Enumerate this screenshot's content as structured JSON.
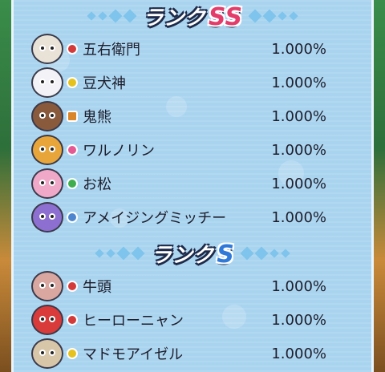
{
  "sections": [
    {
      "title_word": "ランク",
      "title_letter": "SS",
      "rows": [
        {
          "name": "五右衛門",
          "rate": "1.000%",
          "avatar_color": "#e9e2d6",
          "tribe_color": "#d43a3a",
          "tribe_icon": "brave-tribe-icon"
        },
        {
          "name": "豆犬神",
          "rate": "1.000%",
          "avatar_color": "#f2f2f7",
          "tribe_color": "#e6c21f",
          "tribe_icon": "mysterious-tribe-icon"
        },
        {
          "name": "鬼熊",
          "rate": "1.000%",
          "avatar_color": "#8a5a3c",
          "tribe_color": "#d9852a",
          "tribe_icon": "tough-tribe-icon"
        },
        {
          "name": "ワルノリン",
          "rate": "1.000%",
          "avatar_color": "#e8a63a",
          "tribe_color": "#e55a93",
          "tribe_icon": "charming-tribe-icon"
        },
        {
          "name": "お松",
          "rate": "1.000%",
          "avatar_color": "#f0a8c8",
          "tribe_color": "#3fae4f",
          "tribe_icon": "heartful-tribe-icon"
        },
        {
          "name": "アメイジングミッチー",
          "rate": "1.000%",
          "avatar_color": "#8d6fd1",
          "tribe_color": "#4d86cf",
          "tribe_icon": "shady-tribe-icon"
        }
      ]
    },
    {
      "title_word": "ランク",
      "title_letter": "S",
      "rows": [
        {
          "name": "牛頭",
          "rate": "1.000%",
          "avatar_color": "#d9a6a0",
          "tribe_color": "#d43a3a",
          "tribe_icon": "brave-tribe-icon"
        },
        {
          "name": "ヒーローニャン",
          "rate": "1.000%",
          "avatar_color": "#d93a3a",
          "tribe_color": "#d43a3a",
          "tribe_icon": "brave-tribe-icon"
        },
        {
          "name": "マドモアイゼル",
          "rate": "1.000%",
          "avatar_color": "#d8c6a8",
          "tribe_color": "#e6c21f",
          "tribe_icon": "mysterious-tribe-icon"
        }
      ]
    }
  ]
}
